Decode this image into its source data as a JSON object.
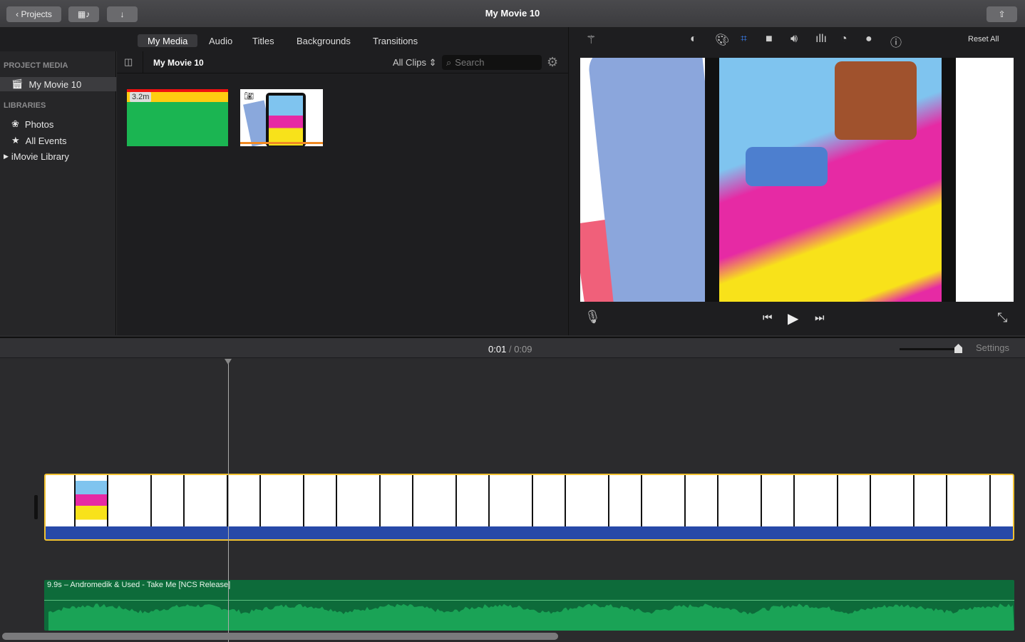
{
  "window": {
    "title": "My Movie 10"
  },
  "toolbar": {
    "projects_label": "Projects",
    "media_icon": "film-music-icon",
    "import_icon": "download-arrow-icon",
    "share_icon": "share-icon"
  },
  "browser_tabs": [
    {
      "label": "My Media",
      "active": true
    },
    {
      "label": "Audio"
    },
    {
      "label": "Titles"
    },
    {
      "label": "Backgrounds"
    },
    {
      "label": "Transitions"
    }
  ],
  "sidebar": {
    "project_media_header": "PROJECT MEDIA",
    "project_item": "My Movie 10",
    "libraries_header": "LIBRARIES",
    "items": [
      {
        "label": "Photos",
        "icon": "flower-icon"
      },
      {
        "label": "All Events",
        "icon": "star-icon"
      }
    ],
    "library": "iMovie Library"
  },
  "browser": {
    "title": "My Movie 10",
    "filter": "All Clips",
    "search_placeholder": "Search",
    "clips": [
      {
        "duration": "3.2m",
        "type": "video"
      },
      {
        "type": "photo"
      }
    ]
  },
  "viewer": {
    "reset_label": "Reset All",
    "active_tool": "crop",
    "accent": "#3b82f6"
  },
  "timeline": {
    "current": "0:01",
    "separator": "/",
    "total": "0:09",
    "settings_label": "Settings",
    "audio_clip": "9.9s – Andromedik & Used - Take Me [NCS Release]"
  },
  "colors": {
    "clip_border": "#f1c232",
    "audio": "#0d6b3a",
    "waveform": "#1aa356"
  }
}
